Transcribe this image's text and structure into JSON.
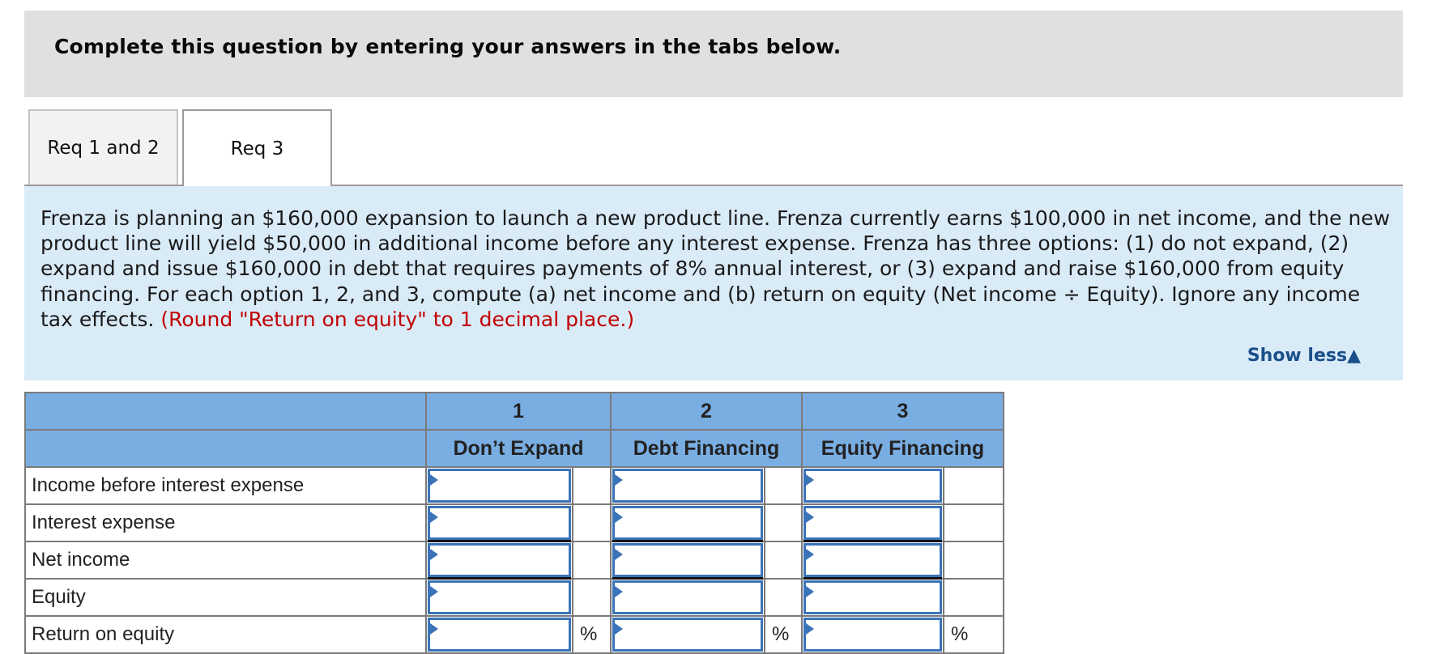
{
  "header": {
    "title": "Complete this question by entering your answers in the tabs below."
  },
  "tabs": [
    {
      "label": "Req 1 and 2",
      "active": false
    },
    {
      "label": "Req 3",
      "active": true
    }
  ],
  "question": {
    "text": "Frenza is planning an $160,000 expansion to launch a new product line. Frenza currently earns $100,000 in net income, and the new product line will yield $50,000 in additional income before any interest expense. Frenza has three options: (1) do not expand, (2) expand and issue $160,000 in debt that requires payments of 8% annual interest, or (3) expand and raise $160,000 from equity financing. For each option 1, 2, and 3, compute (a) net income and (b) return on equity (Net income ÷ Equity). Ignore any income tax effects. ",
    "instruction": "(Round \"Return on equity\" to 1 decimal place.)",
    "show_less_label": "Show less",
    "show_less_icon": "▲"
  },
  "table": {
    "columns": [
      {
        "number": "1",
        "title": "Don’t Expand"
      },
      {
        "number": "2",
        "title": "Debt Financing"
      },
      {
        "number": "3",
        "title": "Equity Financing"
      }
    ],
    "rows": [
      {
        "label": "Income before interest expense",
        "values": [
          "",
          "",
          ""
        ],
        "suffix": ""
      },
      {
        "label": "Interest expense",
        "values": [
          "",
          "",
          ""
        ],
        "suffix": ""
      },
      {
        "label": "Net income",
        "values": [
          "",
          "",
          ""
        ],
        "suffix": ""
      },
      {
        "label": "Equity",
        "values": [
          "",
          "",
          ""
        ],
        "suffix": ""
      },
      {
        "label": "Return on equity",
        "values": [
          "",
          "",
          ""
        ],
        "suffix": "%"
      }
    ]
  },
  "colors": {
    "header_bg": "#e0e0e0",
    "panel_bg": "#daebf8",
    "table_header_bg": "#7aaee3",
    "input_border": "#3b73b9",
    "instruction_red": "#c00000",
    "link_blue": "#1a4f8a"
  }
}
